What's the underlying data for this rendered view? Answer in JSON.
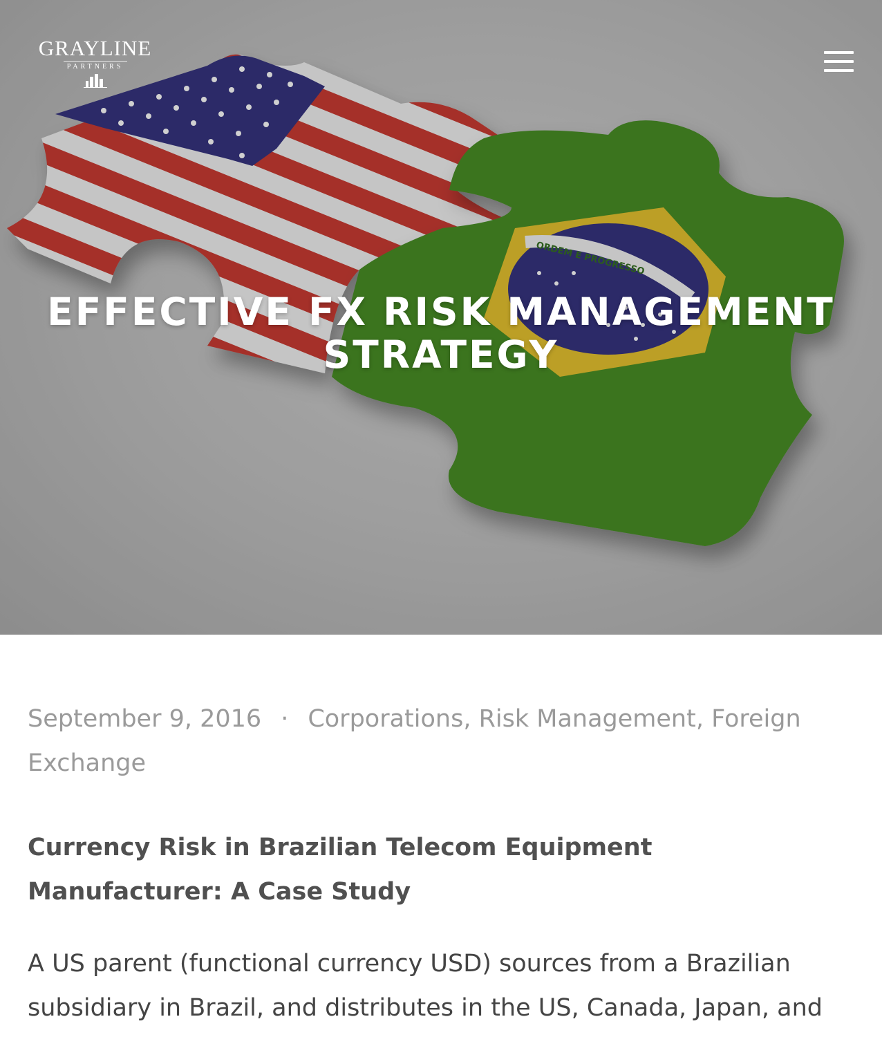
{
  "brand": {
    "name": "GRAYLINE",
    "tagline": "PARTNERS"
  },
  "nav": {
    "menu_icon": "hamburger-menu-icon"
  },
  "hero": {
    "title": "EFFECTIVE FX RISK MANAGEMENT STRATEGY",
    "image_text": "ORDEM E PROGRESSO"
  },
  "post": {
    "date": "September 9, 2016",
    "separator": "·",
    "categories": [
      "Corporations",
      "Risk Management",
      "Foreign Exchange"
    ],
    "subtitle": "Currency Risk in Brazilian Telecom Equipment Manufacturer: A Case Study",
    "body": "A US parent (functional currency USD) sources from a Brazilian subsidiary in Brazil, and distributes in the US, Canada, Japan, and"
  },
  "colors": {
    "flag_red": "#c8332b",
    "flag_blue": "#2d2b7a",
    "flag_green": "#3f8a1e",
    "flag_yellow": "#e6c126",
    "text_muted": "#9a9a9a"
  }
}
